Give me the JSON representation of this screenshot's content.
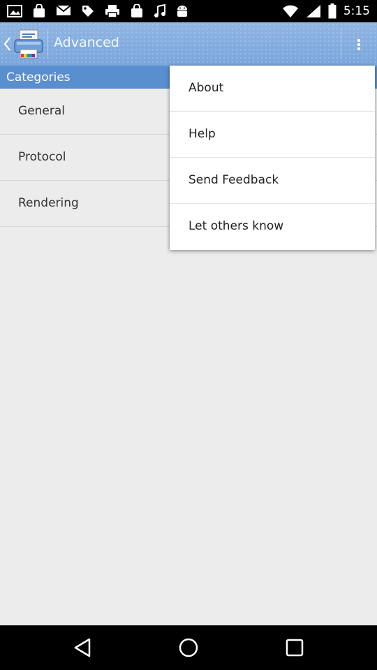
{
  "status_bar": {
    "time": "5:15",
    "left_icons": [
      "image-icon",
      "bag-icon",
      "mail-icon",
      "tag-icon",
      "printer-icon",
      "bag-icon",
      "music-icon",
      "android-icon"
    ],
    "right_icons": [
      "wifi-icon",
      "signal-icon",
      "battery-icon"
    ]
  },
  "action_bar": {
    "title": "Advanced",
    "up_icon": "chevron-left-icon",
    "app_icon": "printer-icon",
    "overflow_icon": "overflow-menu-icon",
    "gradient_top": "#8fb5e3",
    "gradient_bottom": "#7aa6dc"
  },
  "categories": {
    "label": "Categories",
    "color": "#5a8fcf",
    "items": [
      {
        "label": "General"
      },
      {
        "label": "Protocol"
      },
      {
        "label": "Rendering"
      }
    ]
  },
  "overflow_menu": {
    "items": [
      {
        "label": "About"
      },
      {
        "label": "Help"
      },
      {
        "label": "Send Feedback"
      },
      {
        "label": "Let others know"
      }
    ]
  },
  "nav_bar": {
    "buttons": [
      "back-icon",
      "home-icon",
      "recents-icon"
    ]
  }
}
